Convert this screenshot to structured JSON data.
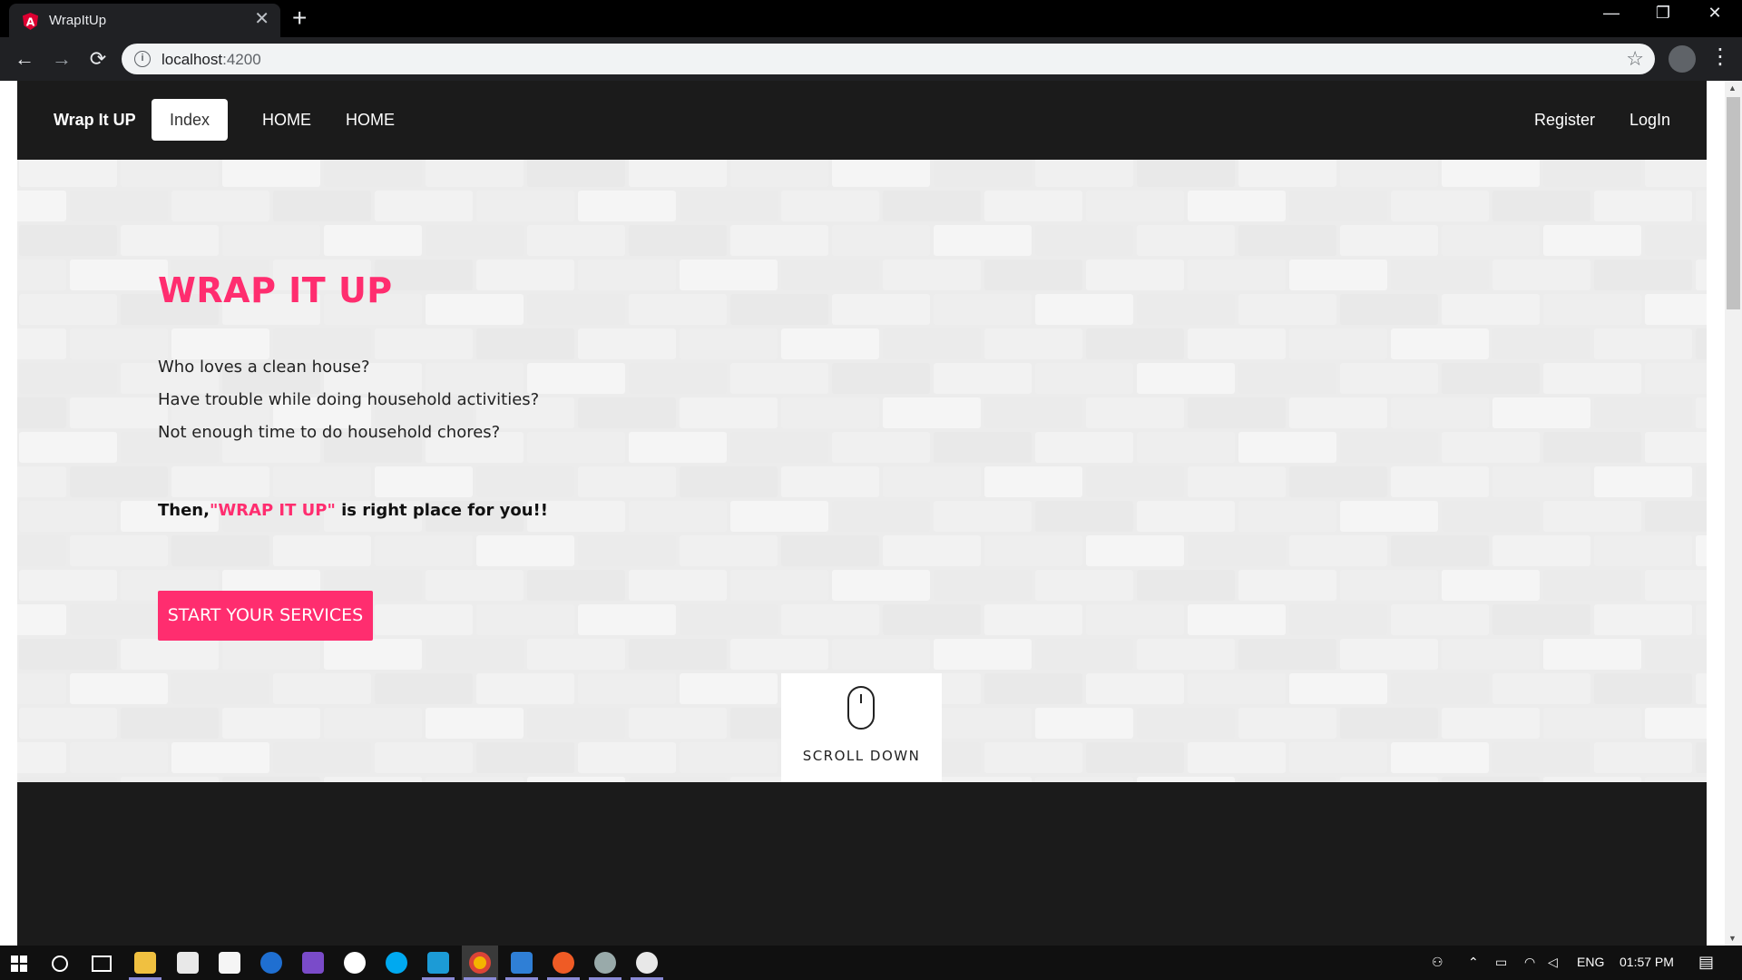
{
  "browser": {
    "tab_title": "WrapItUp",
    "tab_close": "✕",
    "new_tab": "+",
    "url_host": "localhost",
    "url_port": ":4200",
    "window_controls": [
      "—",
      "❐",
      "✕"
    ],
    "nav": {
      "back": "←",
      "forward": "→",
      "reload": "⟳"
    },
    "star": "☆",
    "menu": "⋮"
  },
  "navbar": {
    "brand": "Wrap It UP",
    "items": [
      {
        "label": "Index",
        "active": true
      },
      {
        "label": "HOME",
        "active": false
      },
      {
        "label": "HOME",
        "active": false
      }
    ],
    "right": [
      "Register",
      "LogIn"
    ]
  },
  "hero": {
    "title": "WRAP IT UP",
    "lines": [
      "Who loves a clean house?",
      "Have trouble while doing household activities?",
      "Not enough time to do household chores?"
    ],
    "tag_prefix": "Then,",
    "tag_highlight": "\"WRAP IT UP\"",
    "tag_suffix": " is right place for you!!",
    "cta": "START YOUR SERVICES",
    "scroll_label": "SCROLL DOWN"
  },
  "colors": {
    "accent": "#ff2d6f",
    "navbar_bg": "#1b1b1b",
    "hero_bg": "#ececec"
  },
  "taskbar": {
    "apps": [
      "windows-start-icon",
      "cortana-search-icon",
      "task-view-icon",
      "file-explorer-icon",
      "mail-icon",
      "store-icon",
      "edge-icon",
      "visual-studio-icon",
      "node-icon",
      "skype-icon",
      "webstorm-icon",
      "chrome-icon",
      "screen-icon",
      "postman-icon",
      "dragon-icon",
      "slack-icon"
    ],
    "lang": "ENG",
    "time": "01:57 PM"
  }
}
